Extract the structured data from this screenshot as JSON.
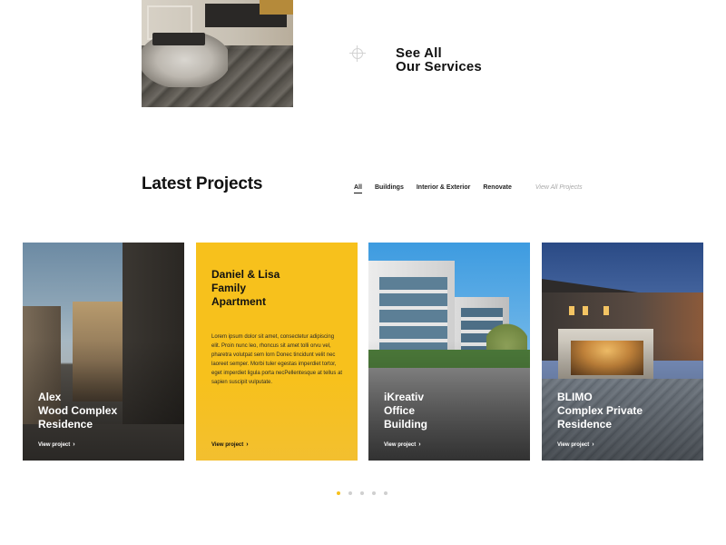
{
  "services": {
    "see_all_line1": "See All",
    "see_all_line2": "Our Services",
    "crosshair_icon": "crosshair-icon"
  },
  "projects": {
    "section_title": "Latest Projects",
    "filters": [
      {
        "label": "All",
        "active": true
      },
      {
        "label": "Buildings",
        "active": false
      },
      {
        "label": "Interior & Exterior",
        "active": false
      },
      {
        "label": "Renovate",
        "active": false
      }
    ],
    "view_all_label": "View All Projects",
    "cards": [
      {
        "title_lines": [
          "Alex",
          "Wood Complex",
          "Residence"
        ],
        "link": "View project",
        "style": "photo"
      },
      {
        "title_lines": [
          "Daniel & Lisa",
          "Family",
          "Apartment"
        ],
        "description": "Lorem ipsum dolor sit amet, consectetur adipiscing elit. Proin nunc leo, rhoncus sit amet tolli orvu vel, pharetra volutpat sem lorn Donec tincidunt velit nec laoreet semper. Morbi tuler egestas imperdiet tortor, eget imperdiet ligula porta necPellentesque at tellus at sapien suscipit vulputate.",
        "link": "View project",
        "style": "highlight"
      },
      {
        "title_lines": [
          "iKreativ",
          "Office",
          "Building"
        ],
        "link": "View project",
        "style": "photo"
      },
      {
        "title_lines": [
          "BLIMO",
          "Complex Private",
          "Residence"
        ],
        "link": "View project",
        "style": "photo"
      }
    ]
  },
  "pagination": {
    "total": 5,
    "active_index": 0
  },
  "colors": {
    "accent": "#f7c11c",
    "text": "#111111",
    "muted": "#a8a8a8"
  }
}
